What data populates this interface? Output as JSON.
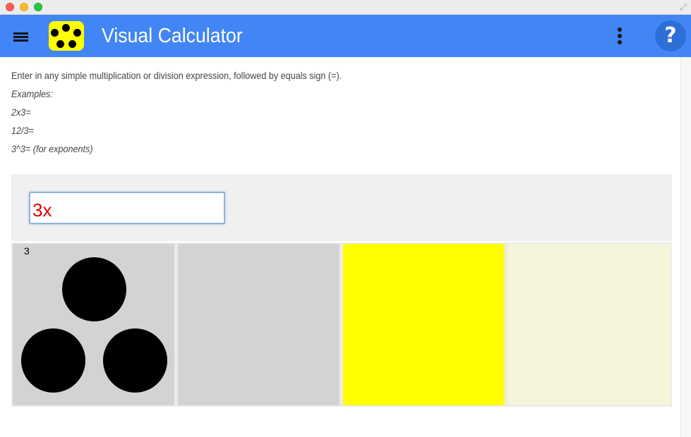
{
  "window": {
    "traffic_lights": [
      "close",
      "minimize",
      "maximize"
    ],
    "fullscreen_icon": "fullscreen-arrows-icon"
  },
  "header": {
    "title": "Visual Calculator",
    "background_color": "#4285f4",
    "logo_icon": "dice-five-icon",
    "menu_icon": "hamburger-menu-icon",
    "overflow_icon": "more-vertical-icon",
    "help_label": "?"
  },
  "instructions": {
    "intro": "Enter in any simple multiplication or division expression, followed by equals sign (=).",
    "examples_label": "Examples:",
    "examples": [
      "2x3=",
      "12/3=",
      "3^3= (for exponents)"
    ]
  },
  "calculator": {
    "expression_value": "3x",
    "expression_color": "#e00000"
  },
  "panels": [
    {
      "count_label": "3",
      "dots": 3,
      "color": "#d3d3d3"
    },
    {
      "count_label": "",
      "dots": 0,
      "color": "#d3d3d3"
    },
    {
      "count_label": "",
      "dots": 0,
      "color": "#ffff00"
    },
    {
      "count_label": "",
      "dots": 0,
      "color": "#f5f5dc"
    }
  ]
}
